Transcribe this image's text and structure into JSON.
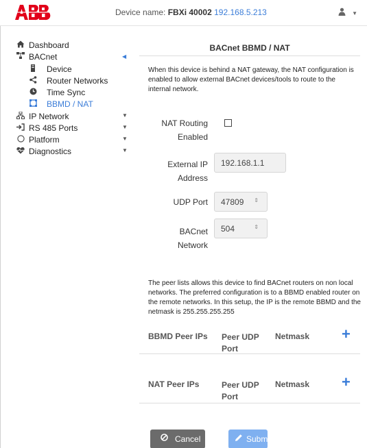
{
  "header": {
    "device_name_label": "Device name:",
    "device_name": "FBXi 40002",
    "device_ip": "192.168.5.213",
    "user_icon": "user-icon",
    "user_caret": "▼"
  },
  "sidebar": {
    "items": [
      {
        "label": "Dashboard",
        "icon": "home-icon"
      },
      {
        "label": "BACnet",
        "icon": "network-tree-icon"
      },
      {
        "label": "Device",
        "icon": "device-icon"
      },
      {
        "label": "Router Networks",
        "icon": "share-icon"
      },
      {
        "label": "Time Sync",
        "icon": "clock-icon"
      },
      {
        "label": "BBMD / NAT",
        "icon": "bbmd-icon"
      },
      {
        "label": "IP Network",
        "icon": "ip-network-icon"
      },
      {
        "label": "RS 485 Ports",
        "icon": "port-plug-icon"
      },
      {
        "label": "Platform",
        "icon": "platform-circle-icon"
      },
      {
        "label": "Diagnostics",
        "icon": "heartbeat-icon"
      }
    ],
    "active_item": "BBMD / NAT",
    "accent_color": "#3b7dd8"
  },
  "panel": {
    "title": "BACnet BBMD / NAT",
    "intro": "When this device is behind a NAT gateway, the NAT configuration is enabled to allow external BACnet devices/tools to route to the internal network.",
    "nat_routing_label_line1": "NAT Routing",
    "nat_routing_label_line2": "Enabled",
    "nat_routing_enabled": false,
    "external_ip_label_line1": "External IP",
    "external_ip_label_line2": "Address",
    "external_ip_value": "192.168.1.1",
    "udp_port_label": "UDP Port",
    "udp_port_value": "47809",
    "bacnet_network_label_line1": "BACnet",
    "bacnet_network_label_line2": "Network",
    "bacnet_network_value": "504",
    "peer_intro": "The peer lists allows this device to find BACnet routers on non local networks. The preferred configuration is to a BBMD enabled router on the remote networks. In this setup, the IP is the remote BBMD and the netmask is 255.255.255.255"
  },
  "bbmd_table": {
    "col1": "BBMD Peer IPs",
    "col2": "Peer UDP Port",
    "col3": "Netmask",
    "add": "+"
  },
  "nat_table": {
    "col1": "NAT Peer IPs",
    "col2": "Peer UDP Port",
    "col3": "Netmask",
    "add": "+"
  },
  "actions": {
    "cancel_label": "Cancel",
    "submit_label": "Submit"
  },
  "colors": {
    "abb_red": "#e2001a",
    "cancel_bg": "#6b6b6b",
    "submit_bg": "#7fb0f0"
  }
}
